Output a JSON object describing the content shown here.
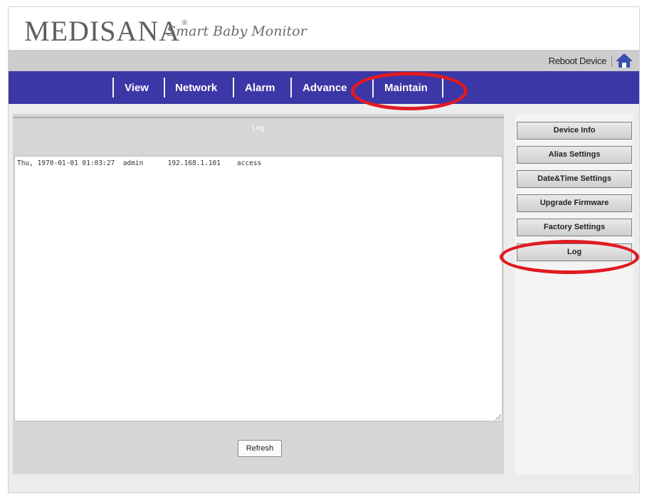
{
  "header": {
    "brand": "MEDISANA",
    "brand_mark": "®",
    "tagline": "Smart Baby Monitor"
  },
  "utility": {
    "reboot_label": "Reboot Device",
    "home_icon": "home-icon"
  },
  "nav": {
    "items": [
      {
        "label": "View"
      },
      {
        "label": "Network"
      },
      {
        "label": "Alarm"
      },
      {
        "label": "Advance"
      },
      {
        "label": "Maintain"
      }
    ],
    "active": "Maintain"
  },
  "content": {
    "title": "Log",
    "log_text": "Thu, 1970-01-01 01:03:27  admin      192.168.1.101    access",
    "refresh_label": "Refresh"
  },
  "sidebar": {
    "items": [
      {
        "label": "Device Info"
      },
      {
        "label": "Alias Settings"
      },
      {
        "label": "Date&Time Settings"
      },
      {
        "label": "Upgrade Firmware"
      },
      {
        "label": "Factory Settings"
      },
      {
        "label": "Log"
      }
    ]
  },
  "colors": {
    "nav_bar": "#3c37a6",
    "annotation": "#e11a22"
  }
}
